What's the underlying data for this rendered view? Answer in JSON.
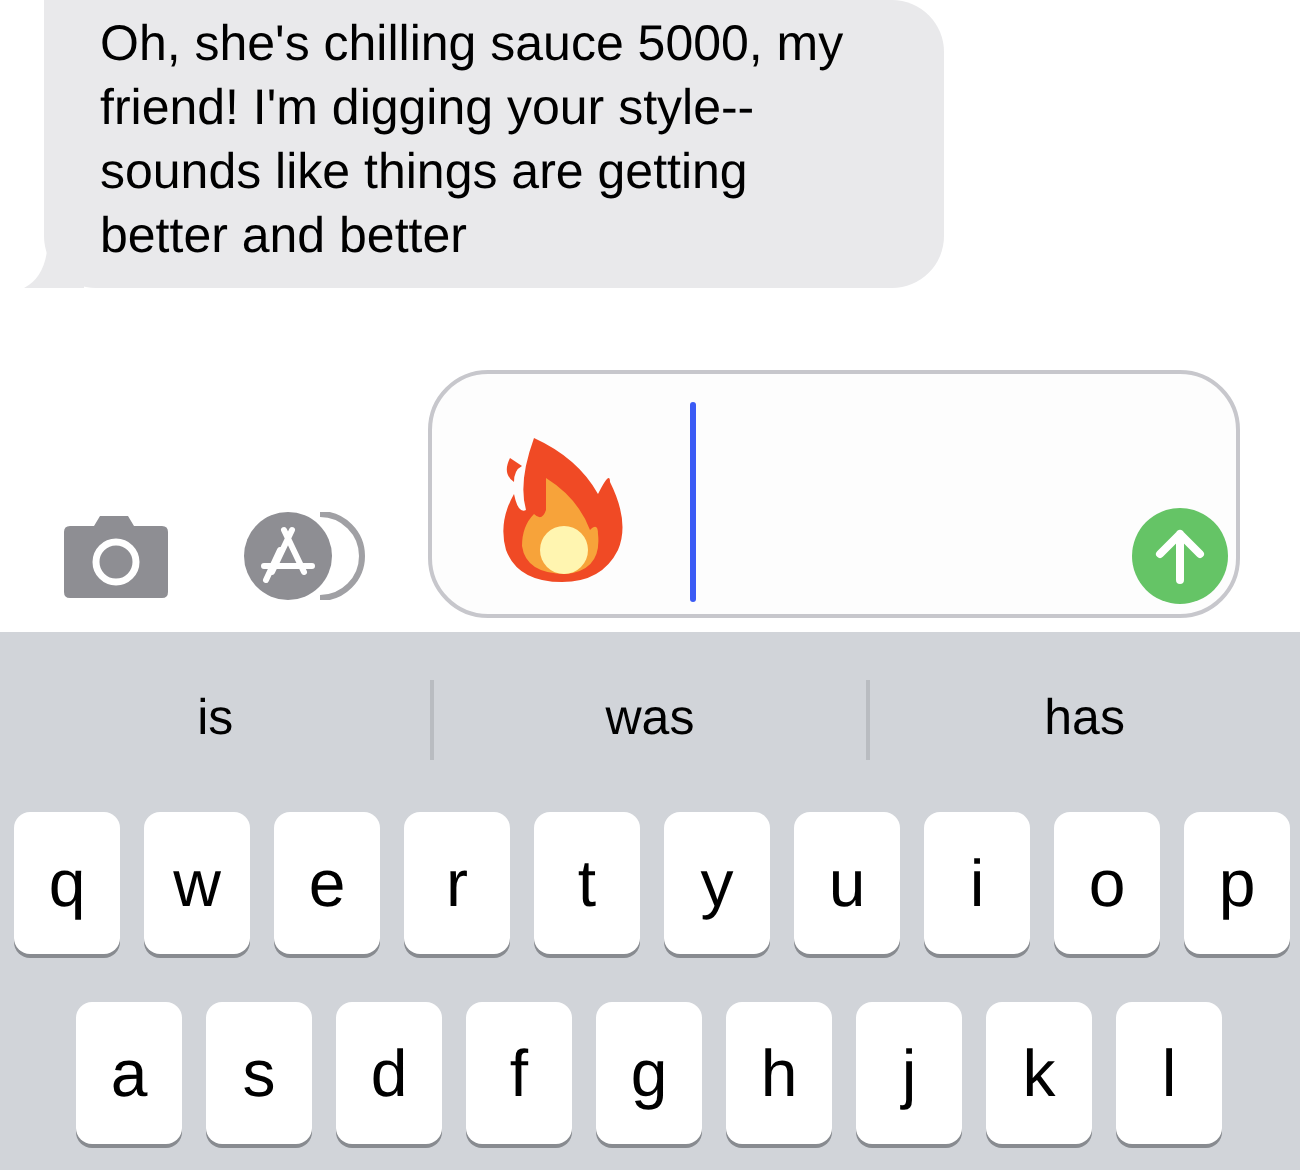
{
  "message": {
    "text": "Oh, she's chilling sauce 5000, my friend!  I'm digging your style--sounds like things are getting better and better"
  },
  "suggestions": [
    "is",
    "was",
    "has"
  ],
  "keyboard_rows": [
    [
      "q",
      "w",
      "e",
      "r",
      "t",
      "y",
      "u",
      "i",
      "o",
      "p"
    ],
    [
      "a",
      "s",
      "d",
      "f",
      "g",
      "h",
      "j",
      "k",
      "l"
    ]
  ]
}
